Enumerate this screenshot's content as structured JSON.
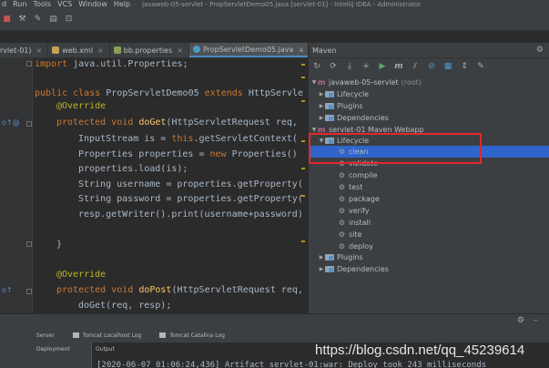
{
  "menu": {
    "items": [
      "d",
      "Run",
      "Tools",
      "VCS",
      "Window",
      "Help"
    ],
    "window_title": "javaweb-05-servlet - PropServletDemo05.java [servlet-01] - IntelliJ IDEA - Administrator"
  },
  "tabs": {
    "items": [
      {
        "label": "rvlet-01)",
        "close": "×"
      },
      {
        "label": "web.xml",
        "close": "×"
      },
      {
        "label": "bb.properties",
        "close": "×"
      },
      {
        "label": "PropServletDemo05.java",
        "close": "×"
      }
    ],
    "overflow": "⌄"
  },
  "code": {
    "l1_kw": "import",
    "l1_rest": " java.util.Properties;",
    "l2_kw": "public class",
    "l2_name": " PropServletDemo05 ",
    "l2_kw2": "extends",
    "l2_rest": " HttpServle",
    "l3": "@Override",
    "l4_kw": "protected void",
    "l4_fn": " doGet",
    "l4_rest": "(HttpServletRequest req,",
    "l5_a": "InputStream is = ",
    "l5_kw": "this",
    "l5_b": ".getServletContext(",
    "l6_a": "Properties properties = ",
    "l6_kw": "new",
    "l6_b": " Properties()",
    "l7": "properties.load(is);",
    "l8": "String username = properties.getProperty(",
    "l9": "String password = properties.getProperty(",
    "l10": "resp.getWriter().print(username+password)",
    "l11": "}",
    "l12": "@Override",
    "l13_kw": "protected void",
    "l13_fn": " doPost",
    "l13_rest": "(HttpServletRequest req,",
    "l14": "doGet(req, resp);"
  },
  "gutter": {
    "override_mark_1": "o↑@",
    "override_mark_2": "o↑"
  },
  "maven": {
    "title": "Maven",
    "tree": {
      "root": {
        "label": "javaweb-05-servlet",
        "suffix": "(root)"
      },
      "lifecycle": "Lifecycle",
      "plugins": "Plugins",
      "dependencies": "Dependencies",
      "module": "servlet-01 Maven Webapp",
      "module_lifecycle": "Lifecycle",
      "goals": [
        "clean",
        "validate",
        "compile",
        "test",
        "package",
        "verify",
        "install",
        "site",
        "deploy"
      ],
      "module_plugins": "Plugins",
      "module_dependencies": "Dependencies"
    }
  },
  "bottom": {
    "tabs": [
      "Server",
      "Tomcat Localhost Log",
      "Tomcat Catalina Log"
    ],
    "deployment_label": "Deployment",
    "output_label": "Output",
    "output_line": "[2020-06-07 01:06:24,436] Artifact servlet-01:war: Deploy took 243 milliseconds"
  },
  "watermark": "https://blog.csdn.net/qq_45239614",
  "colors": {
    "selection": "#2f65ca",
    "annotation": "#e0282d",
    "keyword": "#cc7832",
    "annotation_code": "#bbb529",
    "method": "#ffc66d"
  }
}
